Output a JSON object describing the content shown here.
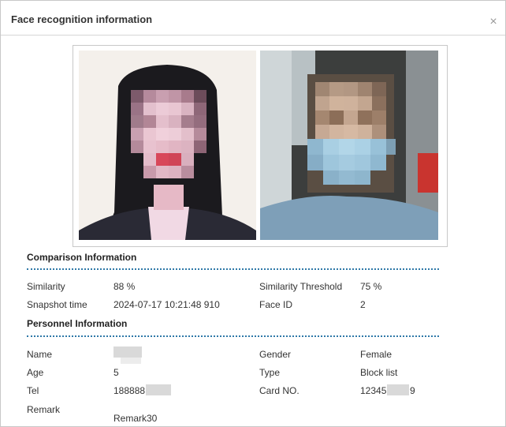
{
  "dialog": {
    "title": "Face recognition information",
    "close_icon": "×"
  },
  "comparison": {
    "heading": "Comparison Information",
    "similarity_label": "Similarity",
    "similarity_value": "88 %",
    "threshold_label": "Similarity Threshold",
    "threshold_value": "75 %",
    "snapshot_label": "Snapshot time",
    "snapshot_value": "2024-07-17 10:21:48 910",
    "faceid_label": "Face ID",
    "faceid_value": "2"
  },
  "personnel": {
    "heading": "Personnel Information",
    "name_label": "Name",
    "gender_label": "Gender",
    "gender_value": "Female",
    "age_label": "Age",
    "age_value": "5",
    "type_label": "Type",
    "type_value": "Block list",
    "tel_label": "Tel",
    "tel_value": "188888",
    "card_label": "Card NO.",
    "card_value_start": "12345",
    "card_value_end": "9",
    "remark_label": "Remark",
    "remark_value": "Remark30"
  },
  "colors": {
    "accent_dots": "#2f79a8",
    "border": "#c8c8c8"
  }
}
